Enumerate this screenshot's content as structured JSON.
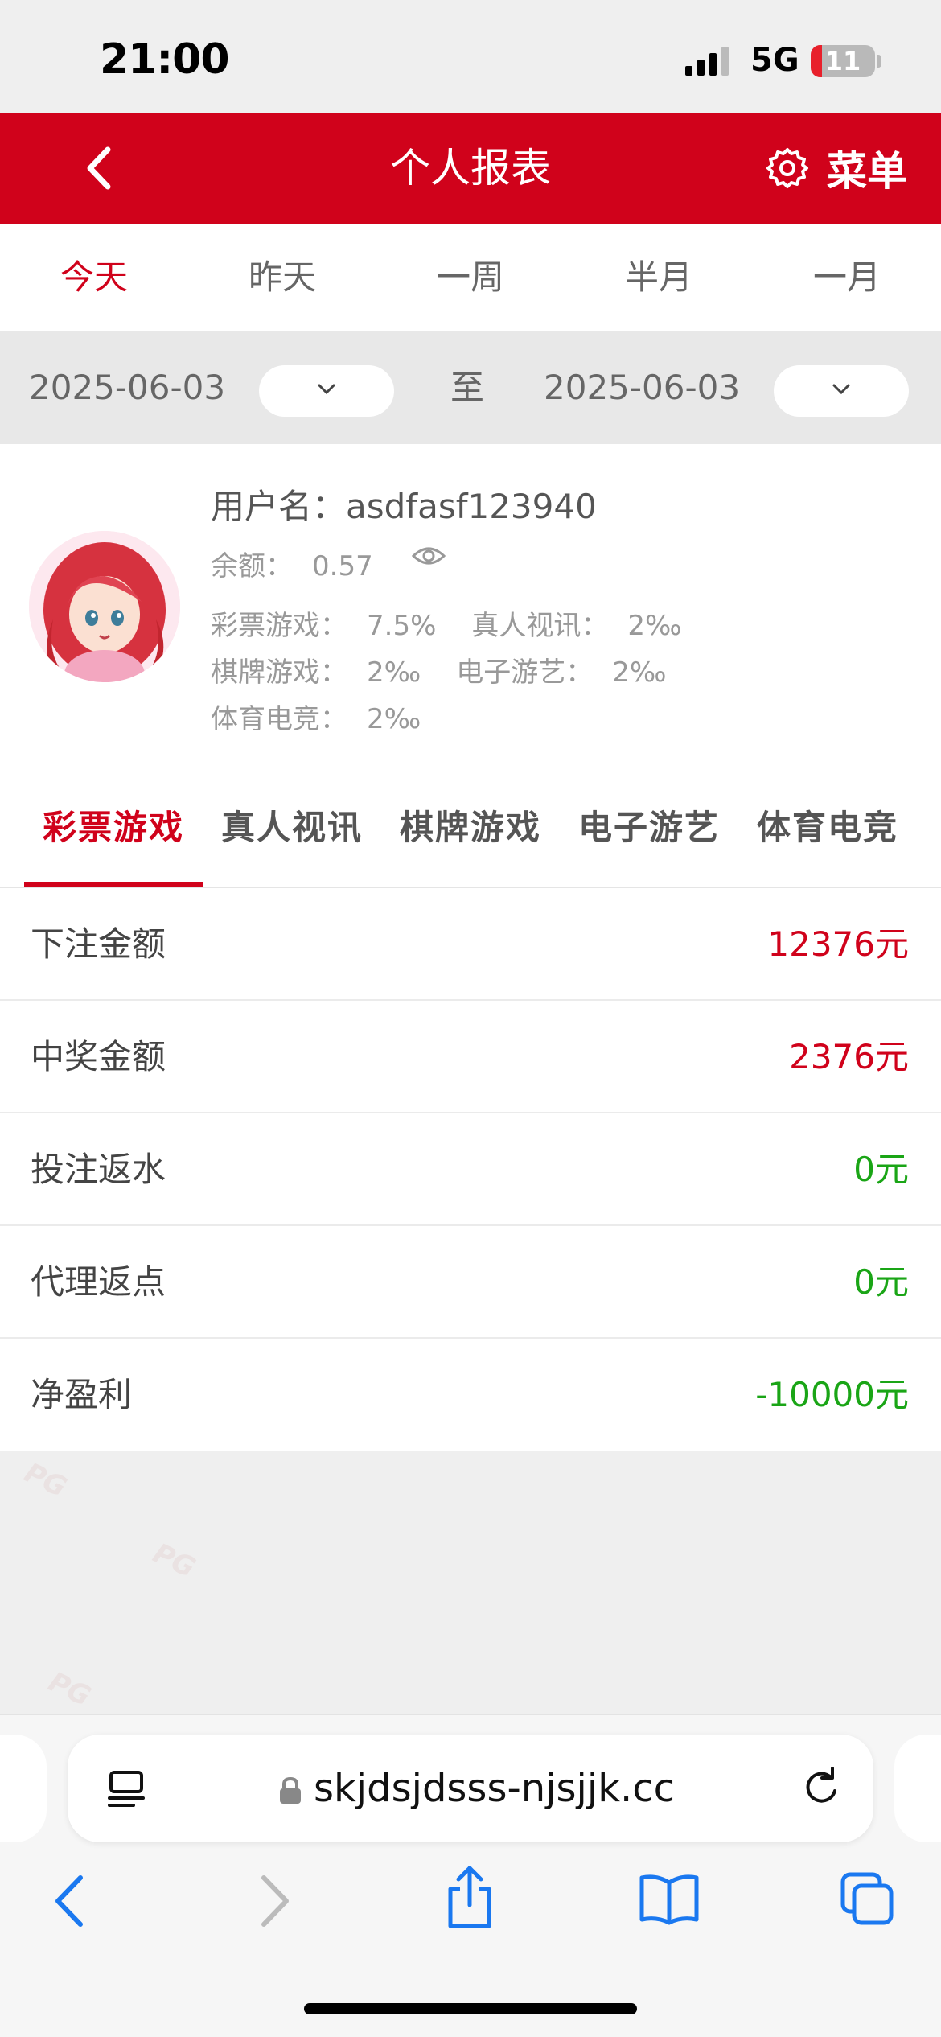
{
  "status_bar": {
    "time": "21:00",
    "network": "5G",
    "battery": "11"
  },
  "nav": {
    "title": "个人报表",
    "menu_label": "菜单"
  },
  "period_tabs": [
    {
      "label": "今天",
      "active": true
    },
    {
      "label": "昨天",
      "active": false
    },
    {
      "label": "一周",
      "active": false
    },
    {
      "label": "半月",
      "active": false
    },
    {
      "label": "一月",
      "active": false
    }
  ],
  "date_range": {
    "start": "2025-06-03",
    "separator": "至",
    "end": "2025-06-03"
  },
  "profile": {
    "username_label": "用户名：",
    "username": "asdfasf123940",
    "balance_label": "余额：",
    "balance": "0.57",
    "rates": {
      "lottery_label": "彩票游戏：",
      "lottery": "7.5%",
      "live_label": "真人视讯：",
      "live": "2‰",
      "chess_label": "棋牌游戏：",
      "chess": "2‰",
      "egame_label": "电子游艺：",
      "egame": "2‰",
      "sports_label": "体育电竞：",
      "sports": "2‰"
    }
  },
  "category_tabs": [
    {
      "label": "彩票游戏",
      "active": true
    },
    {
      "label": "真人视讯",
      "active": false
    },
    {
      "label": "棋牌游戏",
      "active": false
    },
    {
      "label": "电子游艺",
      "active": false
    },
    {
      "label": "体育电竞",
      "active": false
    }
  ],
  "stats": [
    {
      "label": "下注金额",
      "value": "12376元",
      "color": "#d0021b"
    },
    {
      "label": "中奖金额",
      "value": "2376元",
      "color": "#d0021b"
    },
    {
      "label": "投注返水",
      "value": "0元",
      "color": "#1aa516"
    },
    {
      "label": "代理返点",
      "value": "0元",
      "color": "#1aa516"
    },
    {
      "label": "净盈利",
      "value": "-10000元",
      "color": "#1aa516"
    }
  ],
  "browser": {
    "url": "skjdsjdsss-njsjjk.cc"
  },
  "colors": {
    "brand": "#d0021b",
    "positive": "#1aa516"
  },
  "watermark": "PG"
}
